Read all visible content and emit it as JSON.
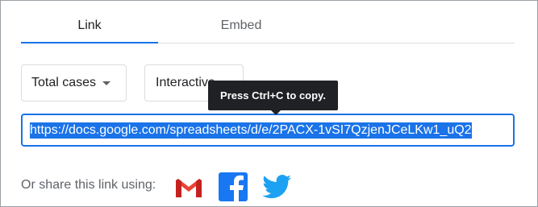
{
  "tabs": [
    {
      "label": "Link",
      "active": true
    },
    {
      "label": "Embed",
      "active": false
    }
  ],
  "dropdowns": {
    "range": {
      "selected": "Total cases"
    },
    "mode": {
      "selected": "Interactive"
    }
  },
  "tooltip": {
    "text": "Press Ctrl+C to copy."
  },
  "link": {
    "value": "https://docs.google.com/spreadsheets/d/e/2PACX-1vSI7QzjenJCeLKw1_uQ2"
  },
  "share": {
    "label": "Or share this link using:",
    "icons": [
      "gmail-icon",
      "facebook-icon",
      "twitter-icon"
    ]
  },
  "colors": {
    "accent": "#1a73e8",
    "gmail_red": "#EA4335",
    "facebook_blue": "#1877F2",
    "twitter_blue": "#1DA1F2"
  }
}
